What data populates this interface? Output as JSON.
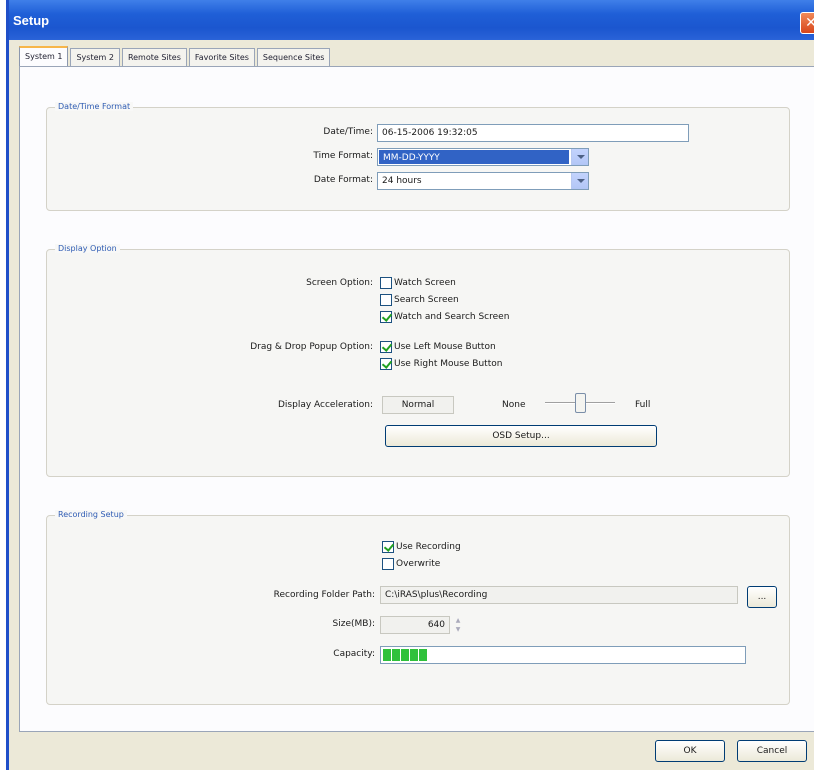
{
  "window": {
    "title": "Setup",
    "close_glyph": "✕"
  },
  "tabs": [
    {
      "label": "System 1",
      "active": true
    },
    {
      "label": "System 2",
      "active": false
    },
    {
      "label": "Remote Sites",
      "active": false
    },
    {
      "label": "Favorite Sites",
      "active": false
    },
    {
      "label": "Sequence Sites",
      "active": false
    }
  ],
  "datetime": {
    "legend": "Date/Time Format",
    "datetime_label": "Date/Time:",
    "datetime_value": "06-15-2006  19:32:05",
    "time_format_label": "Time Format:",
    "time_format_value": "MM-DD-YYYY",
    "date_format_label": "Date Format:",
    "date_format_value": "24 hours"
  },
  "display": {
    "legend": "Display Option",
    "screen_option_label": "Screen Option:",
    "screen_options": [
      {
        "label": "Watch Screen",
        "checked": false
      },
      {
        "label": "Search Screen",
        "checked": false
      },
      {
        "label": "Watch and Search Screen",
        "checked": true
      }
    ],
    "dragdrop_label": "Drag & Drop Popup Option:",
    "dragdrop_options": [
      {
        "label": "Use Left Mouse Button",
        "checked": true
      },
      {
        "label": "Use Right Mouse Button",
        "checked": true
      }
    ],
    "acceleration_label": "Display Acceleration:",
    "acceleration_value": "Normal",
    "slider_min_label": "None",
    "slider_max_label": "Full",
    "slider_level": 0.5,
    "osd_button": "OSD Setup..."
  },
  "recording": {
    "legend": "Recording Setup",
    "use_recording": {
      "label": "Use Recording",
      "checked": true
    },
    "overwrite": {
      "label": "Overwrite",
      "checked": false
    },
    "folder_label": "Recording Folder Path:",
    "folder_value": "C:\\iRAS\\plus\\Recording",
    "browse_label": "...",
    "size_label": "Size(MB):",
    "size_value": "640",
    "capacity_label": "Capacity:",
    "capacity_segments": 5
  },
  "footer": {
    "ok_label": "OK",
    "cancel_label": "Cancel"
  },
  "colors": {
    "titlebar": "#1f5fd7",
    "legend_text": "#2f5cb3",
    "capacity_fill": "#2fc13b",
    "selection": "#3163c5"
  }
}
